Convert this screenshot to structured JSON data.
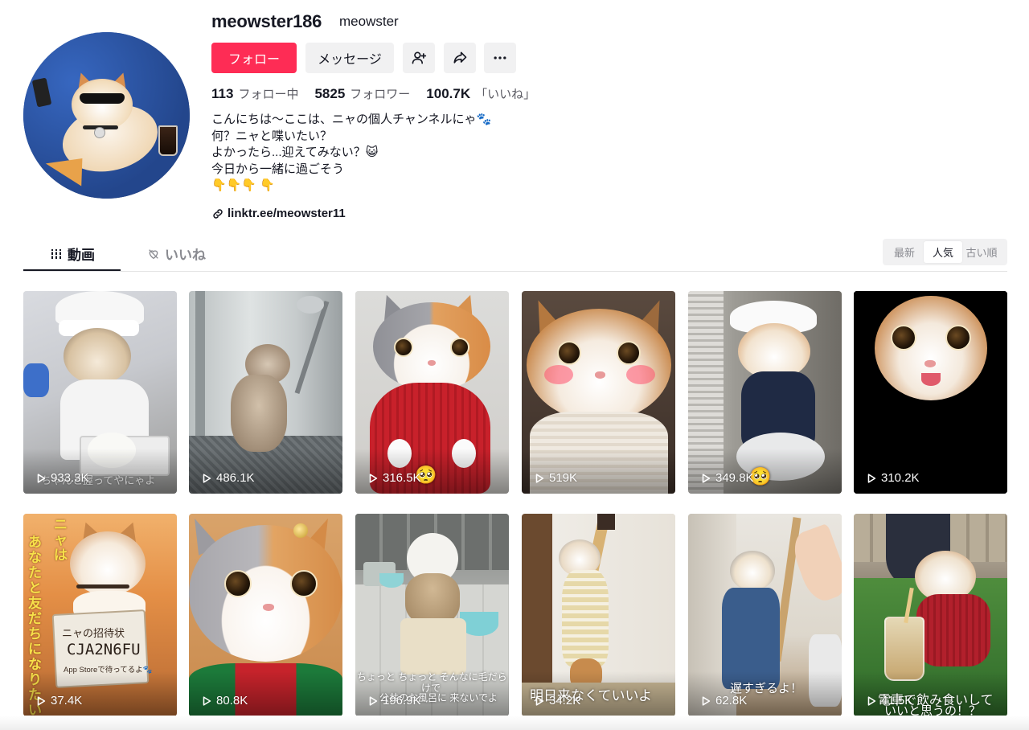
{
  "profile": {
    "username": "meowster186",
    "nickname": "meowster",
    "follow_label": "フォロー",
    "message_label": "メッセージ",
    "stats": [
      {
        "value": "113",
        "label": "フォロー中"
      },
      {
        "value": "5825",
        "label": "フォロワー"
      },
      {
        "value": "100.7K",
        "label": "「いいね」"
      }
    ],
    "bio": [
      "こんにちは〜ここは、ニャの個人チャンネルにゃ🐾",
      "何？ニャと喋いたい？",
      "よかったら...迎えてみない？😺",
      "今日から一緒に過ごそう",
      "👇👇👇 👇"
    ],
    "link": "linktr.ee/meowster11"
  },
  "tabs": {
    "videos": "動画",
    "likes": "いいね"
  },
  "sort": {
    "options": [
      "最新",
      "人気",
      "古い順"
    ],
    "selected": "人気"
  },
  "videos": [
    {
      "views": "933.3K",
      "caption": "ちゃんと握ってやにゃよ"
    },
    {
      "views": "486.1K",
      "caption": ""
    },
    {
      "views": "316.5K",
      "caption": "🥺"
    },
    {
      "views": "519K",
      "caption": ""
    },
    {
      "views": "349.8K",
      "caption": "🥺"
    },
    {
      "views": "310.2K",
      "caption": ""
    },
    {
      "views": "37.4K",
      "caption_lines": [
        "ニャは",
        "あなたと友だちになりたい"
      ],
      "card_lines": [
        "ニャの招待状",
        "CJA2N6FU",
        "App Storeで待ってるよ🐾"
      ]
    },
    {
      "views": "80.8K",
      "caption": ""
    },
    {
      "views": "196.9K",
      "caption_lines": [
        "ちょっと ちょっと そんなに毛だら",
        "けで",
        "公共のお風呂に 来ないでよ"
      ]
    },
    {
      "views": "34.2K",
      "caption": "明日来なくていいよ"
    },
    {
      "views": "62.8K",
      "caption": "遅すぎるよ！"
    },
    {
      "views": "41.5K",
      "caption_lines": [
        "電車で飲み食いして",
        "いいと思うの！？"
      ]
    }
  ]
}
